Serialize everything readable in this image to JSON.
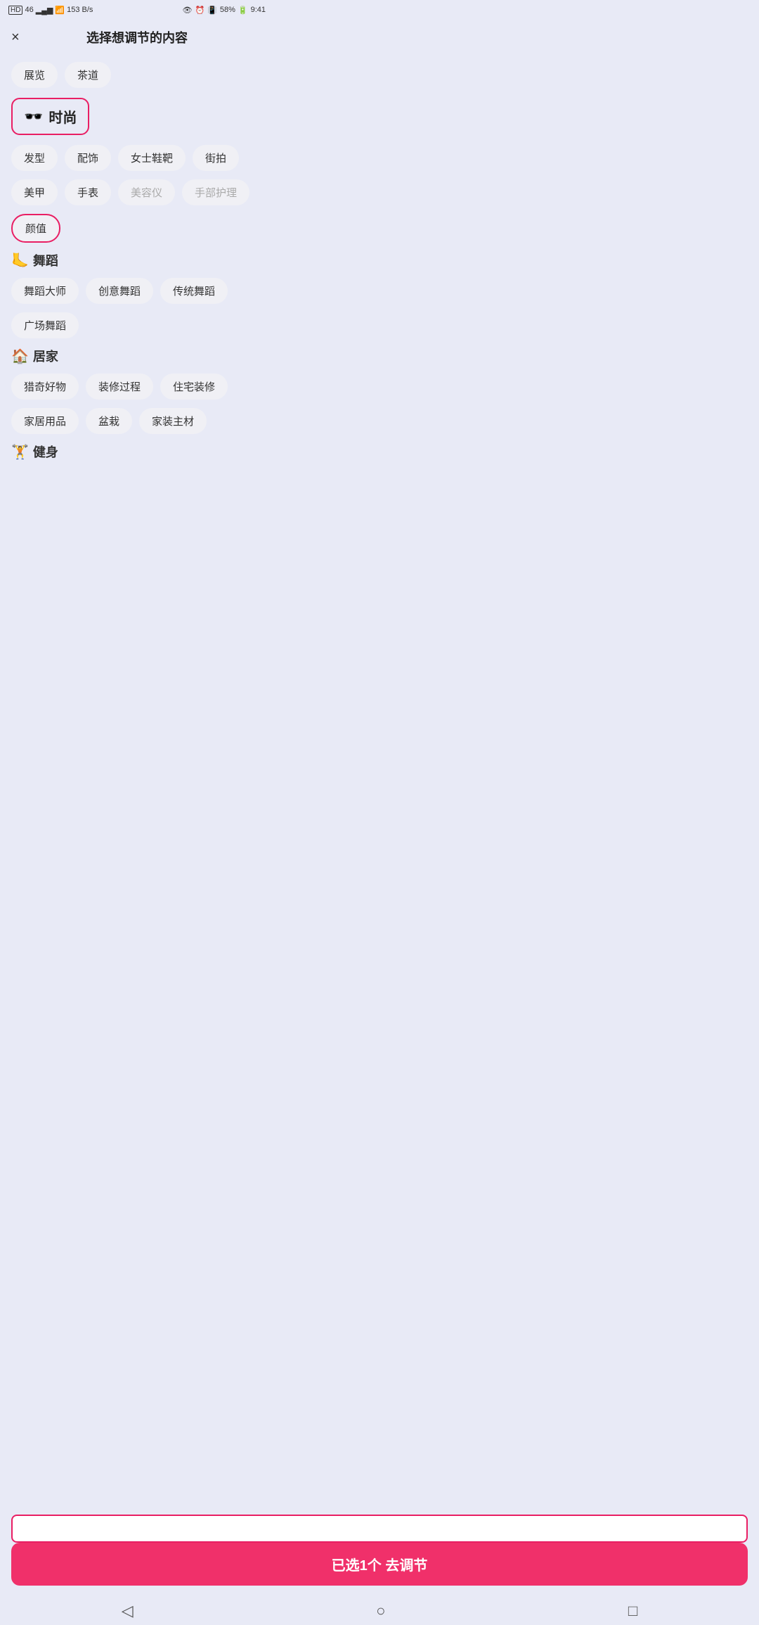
{
  "status_bar": {
    "left": {
      "hd": "HD",
      "signal_4g": "46",
      "wifi": "WiFi",
      "speed": "153 B/s"
    },
    "right": {
      "eye": "👁",
      "alarm": "⏰",
      "vibrate": "📳",
      "battery": "58%",
      "time": "9:41"
    }
  },
  "header": {
    "title": "选择想调节的内容",
    "close_label": "×"
  },
  "top_tags": [
    "展览",
    "茶道"
  ],
  "categories": [
    {
      "id": "fashion",
      "icon": "🕶",
      "label": "时尚",
      "selected": true,
      "sub_tags": [
        {
          "label": "发型",
          "disabled": false,
          "selected": false
        },
        {
          "label": "配饰",
          "disabled": false,
          "selected": false
        },
        {
          "label": "女士鞋靴",
          "disabled": false,
          "selected": false
        },
        {
          "label": "街拍",
          "disabled": false,
          "selected": false
        },
        {
          "label": "美甲",
          "disabled": false,
          "selected": false
        },
        {
          "label": "手表",
          "disabled": false,
          "selected": false
        },
        {
          "label": "美容仪",
          "disabled": true,
          "selected": false
        },
        {
          "label": "手部护理",
          "disabled": true,
          "selected": false
        },
        {
          "label": "颜值",
          "disabled": false,
          "selected": true
        }
      ]
    },
    {
      "id": "dance",
      "icon": "🦶",
      "label": "舞蹈",
      "selected": false,
      "sub_tags": [
        {
          "label": "舞蹈大师",
          "disabled": false,
          "selected": false
        },
        {
          "label": "创意舞蹈",
          "disabled": false,
          "selected": false
        },
        {
          "label": "传统舞蹈",
          "disabled": false,
          "selected": false
        },
        {
          "label": "广场舞蹈",
          "disabled": false,
          "selected": false
        }
      ]
    },
    {
      "id": "home",
      "icon": "🏠",
      "label": "居家",
      "selected": false,
      "sub_tags": [
        {
          "label": "猎奇好物",
          "disabled": false,
          "selected": false
        },
        {
          "label": "装修过程",
          "disabled": false,
          "selected": false
        },
        {
          "label": "住宅装修",
          "disabled": false,
          "selected": false
        },
        {
          "label": "家居用品",
          "disabled": false,
          "selected": false
        },
        {
          "label": "盆栽",
          "disabled": false,
          "selected": false
        },
        {
          "label": "家装主材",
          "disabled": false,
          "selected": false
        }
      ]
    },
    {
      "id": "fitness",
      "icon": "🏋",
      "label": "健身",
      "selected": false,
      "sub_tags": []
    }
  ],
  "action_button": {
    "label": "已选1个 去调节"
  },
  "nav": {
    "back": "◁",
    "home": "○",
    "recent": "□"
  }
}
